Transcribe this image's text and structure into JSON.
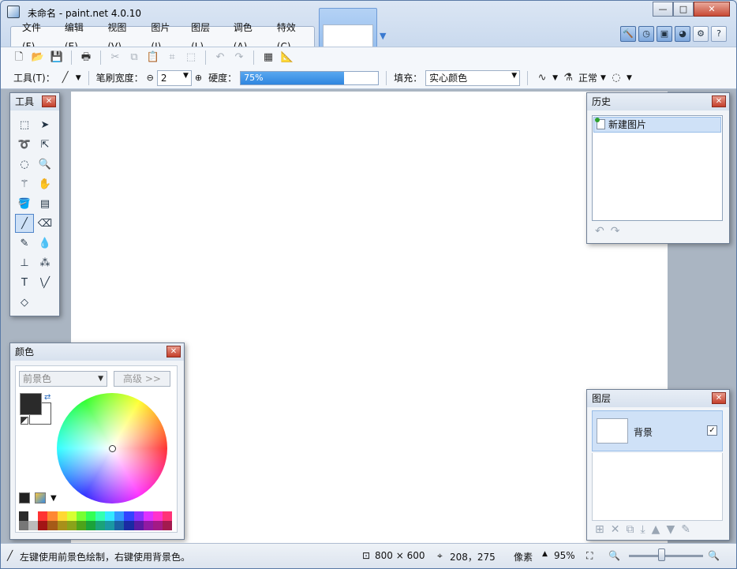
{
  "window": {
    "title": "未命名 - paint.net 4.0.10",
    "min": "—",
    "max": "□",
    "close": "✕"
  },
  "menu": [
    "文件(F)",
    "编辑(E)",
    "视图(V)",
    "图片(I)",
    "图层(L)",
    "调色(A)",
    "特效(C)"
  ],
  "toolbar2": {
    "tool_label": "工具(T)：",
    "brush_label": "笔刷宽度：",
    "brush_value": "2",
    "hardness_label": "硬度：",
    "hardness_value": "75%",
    "hardness_fraction": 0.75,
    "fill_label": "填充：",
    "fill_value": "实心颜色",
    "blend_value": "正常"
  },
  "panels": {
    "tools_title": "工具",
    "history_title": "历史",
    "history_items": [
      "新建图片"
    ],
    "layers_title": "图层",
    "layer_name": "背景",
    "layer_check": "✓",
    "colors_title": "颜色",
    "color_select": "前景色",
    "color_advanced": "高级 >>"
  },
  "colors": {
    "foreground": "#2a2a2a",
    "background": "#ffffff",
    "palette_top": [
      "#2a2a2a",
      "#ffffff",
      "#ff3333",
      "#ff8833",
      "#ffd833",
      "#d8ff33",
      "#77ff33",
      "#33ff55",
      "#33ffb0",
      "#33e8ff",
      "#3399ff",
      "#3344ff",
      "#8833ff",
      "#dd33ff",
      "#ff33cc",
      "#ff3377"
    ],
    "palette_bottom": [
      "#777777",
      "#bbbbbb",
      "#a31515",
      "#a55a18",
      "#a8901a",
      "#8aa31a",
      "#4da31a",
      "#1aa33a",
      "#1aa37a",
      "#1a98a3",
      "#1a62a3",
      "#1a2aa3",
      "#5a1aa3",
      "#911aa3",
      "#a31a86",
      "#a31a4f"
    ]
  },
  "status": {
    "hint": "左键使用前景色绘制，右键使用背景色。",
    "image_size": "800 × 600",
    "cursor_pos": "208，275",
    "unit": "像素",
    "zoom": "95%"
  }
}
